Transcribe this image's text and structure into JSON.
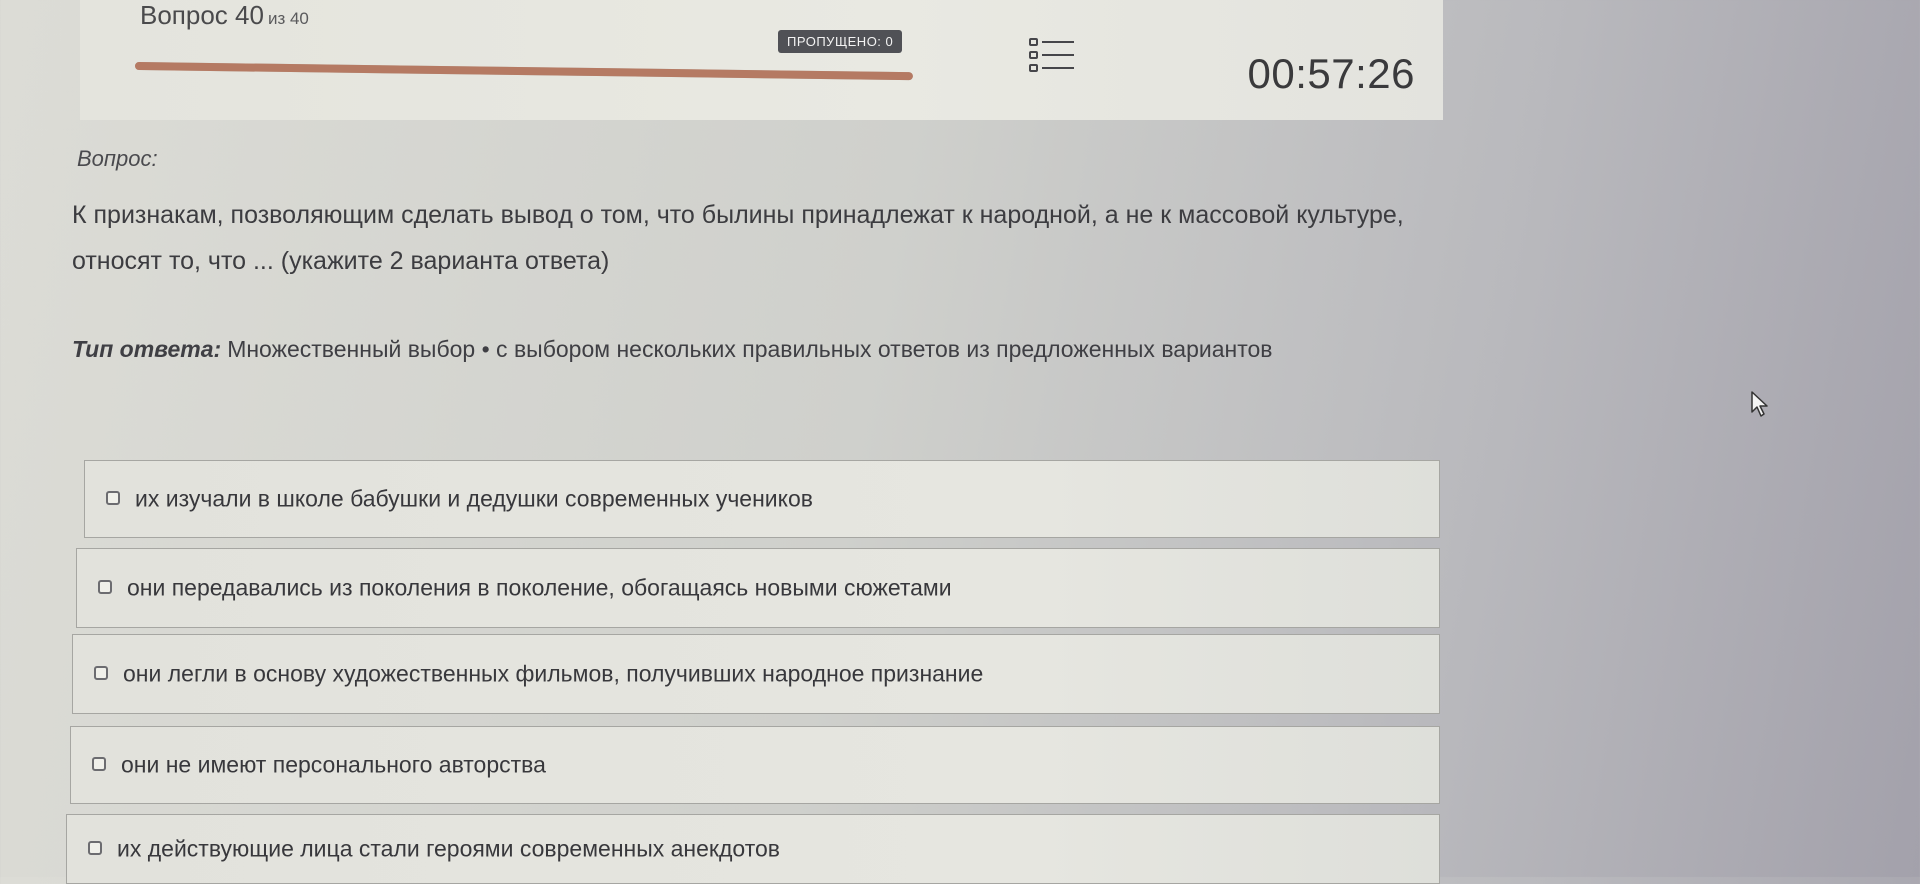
{
  "header": {
    "question_label": "Вопрос 40",
    "question_total": "из 40",
    "progress": 1.0,
    "skipped_label": "ПРОПУЩЕНО: 0",
    "timer": "00:57:26",
    "list_icon": "question-list-icon"
  },
  "question": {
    "label": "Вопрос:",
    "text": "К признакам, позволяющим сделать вывод о том, что былины принадлежат к народной, а не к массовой культуре, относят то, что ... (укажите 2 варианта ответа)",
    "type_label": "Тип ответа:",
    "type_value": "Множественный выбор • с выбором нескольких правильных ответов из предложенных вариантов"
  },
  "options": [
    {
      "text": "их изучали в школе бабушки и дедушки современных учеников",
      "checked": false
    },
    {
      "text": "они передавались из поколения в поколение, обогащаясь новыми сюжетами",
      "checked": false
    },
    {
      "text": "они легли в основу художественных фильмов, получивших народное признание",
      "checked": false
    },
    {
      "text": "они не имеют персонального авторства",
      "checked": false
    },
    {
      "text": "их действующие лица стали героями современных анекдотов",
      "checked": false
    }
  ],
  "colors": {
    "progress_fill": "#b57a63",
    "badge_bg": "#505156"
  }
}
